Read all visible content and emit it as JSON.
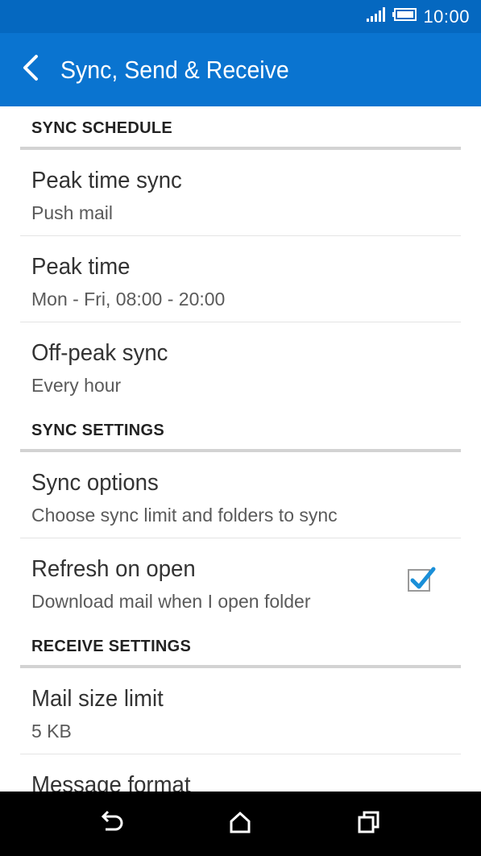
{
  "status_bar": {
    "time": "10:00",
    "icons": [
      "signal-icon",
      "battery-icon"
    ]
  },
  "app_bar": {
    "title": "Sync, Send & Receive",
    "back_icon": "chevron-left-icon"
  },
  "sections": [
    {
      "header": "SYNC SCHEDULE",
      "items": [
        {
          "title": "Peak time sync",
          "subtitle": "Push mail"
        },
        {
          "title": "Peak time",
          "subtitle": "Mon - Fri, 08:00 - 20:00"
        },
        {
          "title": "Off-peak sync",
          "subtitle": "Every hour"
        }
      ]
    },
    {
      "header": "SYNC SETTINGS",
      "items": [
        {
          "title": "Sync options",
          "subtitle": "Choose sync limit and folders to sync"
        },
        {
          "title": "Refresh on open",
          "subtitle": "Download mail when I open folder",
          "checked": true
        }
      ]
    },
    {
      "header": "RECEIVE SETTINGS",
      "items": [
        {
          "title": "Mail size limit",
          "subtitle": "5 KB"
        },
        {
          "title": "Message format",
          "subtitle": ""
        }
      ]
    }
  ],
  "nav_bar": {
    "icons": [
      "back-icon",
      "home-icon",
      "recent-apps-icon"
    ]
  },
  "colors": {
    "status_bar": "#0568c0",
    "app_bar": "#0a74d0",
    "checkbox_tick": "#1a8fd8",
    "nav_bar": "#000000"
  }
}
